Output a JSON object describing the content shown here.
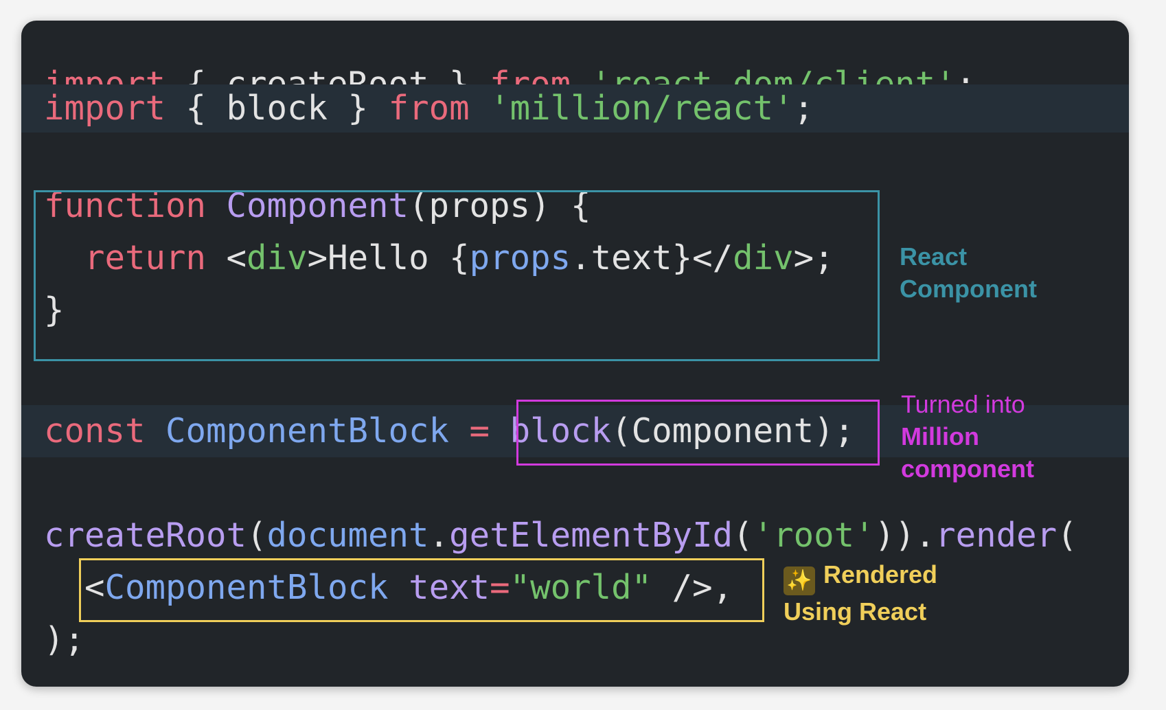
{
  "code": {
    "line1": {
      "kw_import": "import",
      "brace_open": " { ",
      "ident": "createRoot",
      "brace_close": " } ",
      "kw_from": "from",
      "space": " ",
      "module": "'react-dom/client'",
      "semi": ";"
    },
    "line2": {
      "kw_import": "import",
      "brace_open": " { ",
      "ident": "block",
      "brace_close": " } ",
      "kw_from": "from",
      "space": " ",
      "module": "'million/react'",
      "semi": ";"
    },
    "line3": {
      "kw_function": "function",
      "space": " ",
      "name": "Component",
      "params": "(props) {"
    },
    "line4": {
      "indent": "  ",
      "kw_return": "return",
      "lt": " <",
      "tag_open": "div",
      "gt_hello": ">Hello {",
      "props": "props",
      "dot_text": ".text}</",
      "tag_close": "div",
      "end": ">;"
    },
    "line5": {
      "close": "}"
    },
    "line6": {
      "kw_const": "const",
      "space": " ",
      "name": "ComponentBlock",
      "eq": " = ",
      "call": "block",
      "args": "(Component);"
    },
    "line7": {
      "fn_createRoot": "createRoot",
      "paren": "(",
      "obj": "document",
      "dot": ".",
      "method": "getElementById",
      "p_open": "(",
      "arg": "'root'",
      "p_close": ")).",
      "render": "render",
      "end": "("
    },
    "line8": {
      "indent": "  ",
      "lt": "<",
      "component": "ComponentBlock",
      "space": " ",
      "attr": "text",
      "eq": "=",
      "value": "\"world\"",
      "end": " />,"
    },
    "line9": {
      "close": ");"
    }
  },
  "annotations": {
    "react": {
      "line1": "React",
      "line2": "Component"
    },
    "million": {
      "line1": "Turned into",
      "line2": "Million",
      "line3": "component"
    },
    "rendered": {
      "icon": "✨",
      "line1": "Rendered",
      "line2": "Using React"
    }
  },
  "colors": {
    "background": "#212529",
    "keyword": "#ea6a7c",
    "string": "#74c26c",
    "function": "#b89df0",
    "variable": "#7fa8ef",
    "react_box": "#3b93a6",
    "million_box": "#d23ade",
    "rendered_box": "#f0cf5a"
  }
}
